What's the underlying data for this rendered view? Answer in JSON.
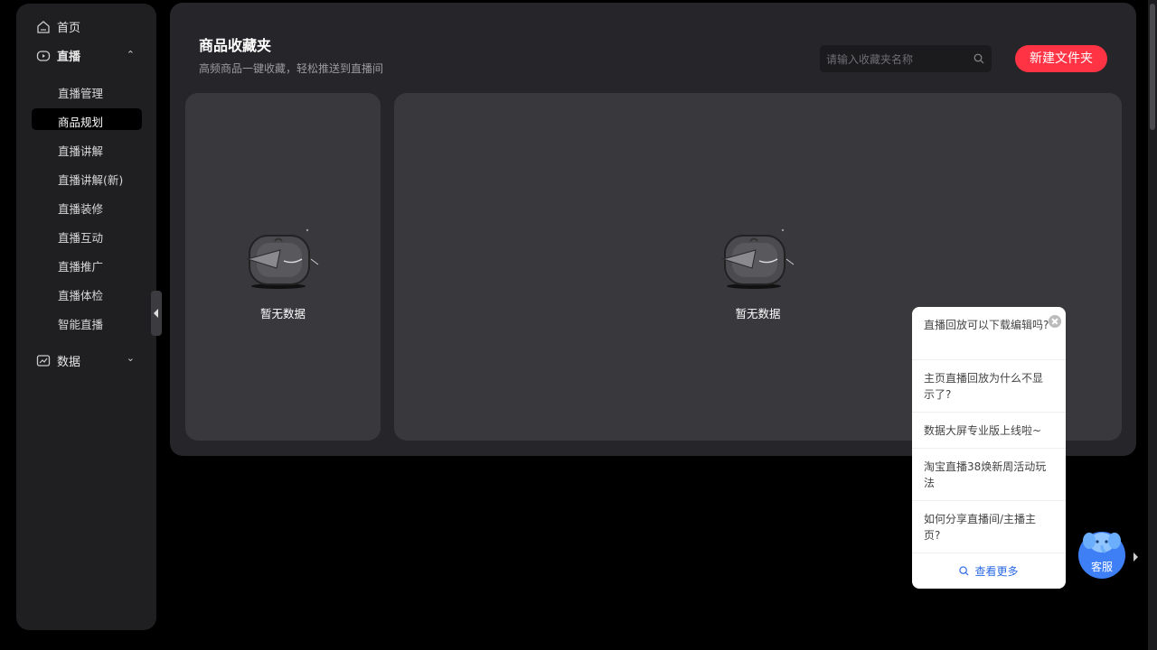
{
  "sidebar": {
    "home": "首页",
    "live": "直播",
    "data": "数据",
    "live_items": [
      "直播管理",
      "商品规划",
      "直播讲解",
      "直播讲解(新)",
      "直播装修",
      "直播互动",
      "直播推广",
      "直播体检",
      "智能直播"
    ]
  },
  "main": {
    "title": "商品收藏夹",
    "subtitle": "高频商品一键收藏，轻松推送到直播间",
    "search_placeholder": "请输入收藏夹名称",
    "new_folder": "新建文件夹",
    "empty_left": "暂无数据",
    "empty_right": "暂无数据"
  },
  "popup": {
    "faqs": [
      "直播回放可以下载编辑吗?",
      "主页直播回放为什么不显示了?",
      "数据大屏专业版上线啦~",
      "淘宝直播38焕新周活动玩法",
      "如何分享直播间/主播主页?"
    ],
    "more": "查看更多"
  },
  "service": {
    "label": "客服"
  },
  "colors": {
    "accent": "#ff3344",
    "link": "#2a6ae6",
    "service": "#3e7ff5"
  }
}
